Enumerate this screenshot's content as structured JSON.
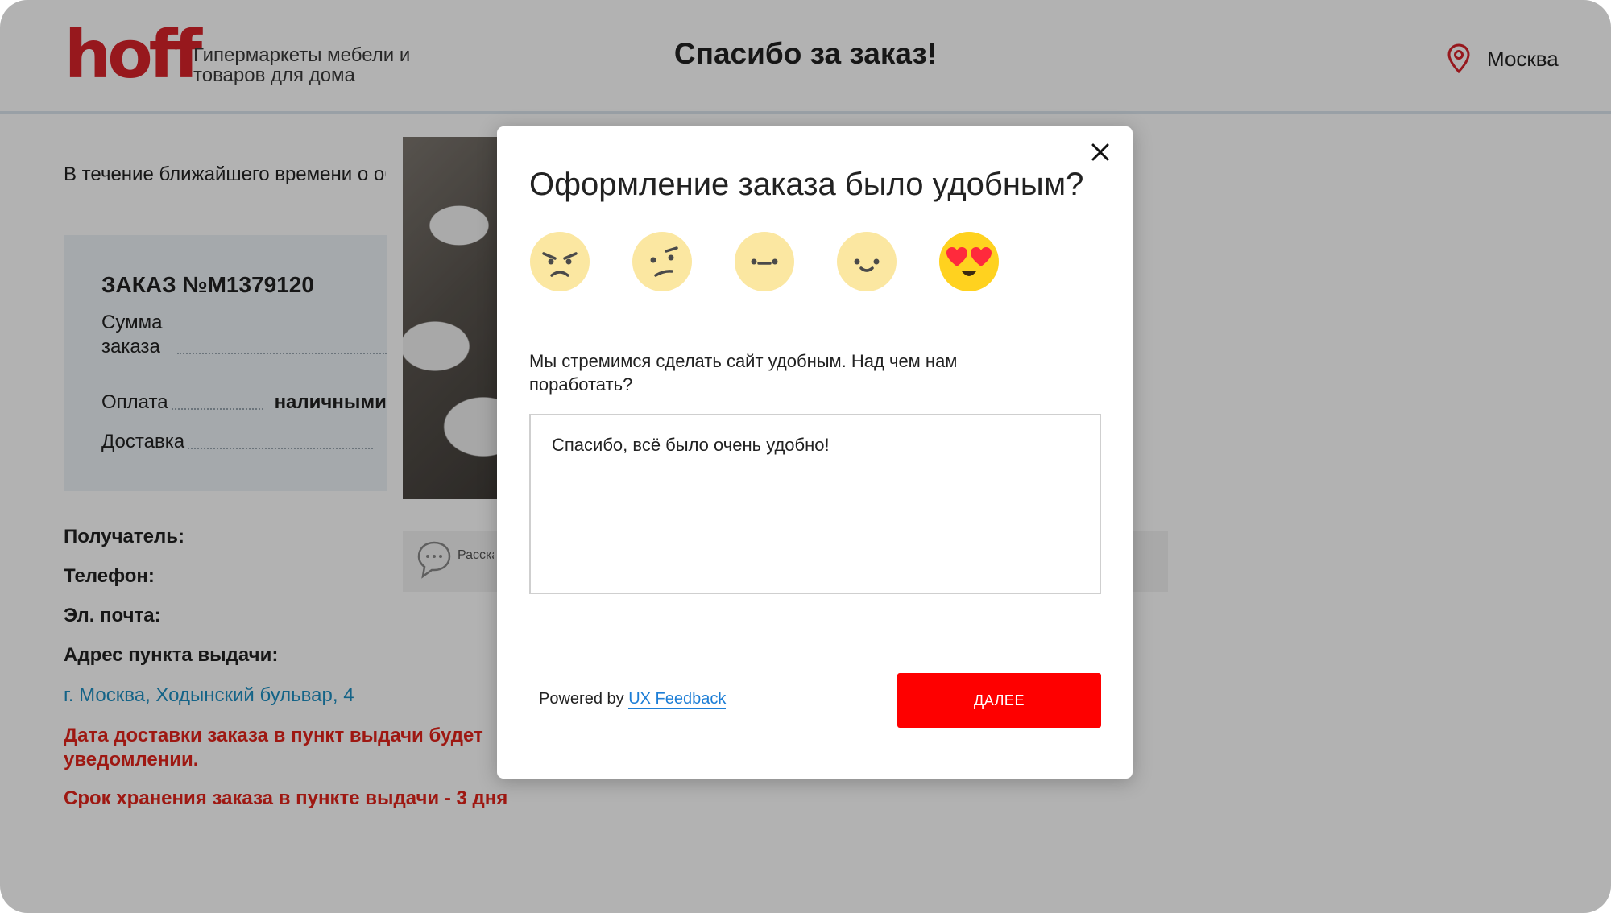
{
  "header": {
    "logo": "hoff",
    "logo_subtitle": "Гипермаркеты мебели и товаров для дома",
    "title": "Спасибо за заказ!",
    "city": "Москва",
    "city_icon": "location-pin-icon"
  },
  "page": {
    "intro": "В течение ближайшего времени о об успешном оформлении заказа",
    "order": {
      "title": "ЗАКАЗ №M1379120",
      "sum_label": "Сумма заказа",
      "payment_label": "Оплата",
      "payment_value": "наличными",
      "delivery_label": "Доставка"
    },
    "details": {
      "recipient_label": "Получатель:",
      "phone_label": "Телефон:",
      "email_label": "Эл. почта:",
      "pickup_label": "Адрес пункта выдачи:",
      "pickup_address": "г. Москва, Ходынский бульвар, 4",
      "delivery_note": "Дата доставки заказа в пункт выдачи будет уведомлении.",
      "storage_note": "Срок хранения заказа в пункте выдачи - 3 дня"
    },
    "promo": {
      "text": "Расска магази",
      "icon": "chat-bubble-icon"
    }
  },
  "modal": {
    "title": "Оформление заказа было удобным?",
    "emojis": [
      {
        "name": "angry-face-icon",
        "selected": false
      },
      {
        "name": "confused-face-icon",
        "selected": false
      },
      {
        "name": "neutral-face-icon",
        "selected": false
      },
      {
        "name": "slight-smile-face-icon",
        "selected": false
      },
      {
        "name": "heart-eyes-face-icon",
        "selected": true
      }
    ],
    "question": "Мы стремимся сделать сайт удобным. Над чем нам поработать?",
    "feedback_text": "Спасибо, всё было очень удобно!",
    "powered_prefix": "Powered by",
    "powered_link": "UX Feedback",
    "next_label": "ДАЛЕЕ",
    "close_icon": "close-icon"
  },
  "colors": {
    "brand_red": "#d8232a",
    "button_red": "#fe0000",
    "link_blue": "#1d8ec2",
    "emoji_pale": "#fbe7a1",
    "emoji_active": "#ffd21f"
  }
}
